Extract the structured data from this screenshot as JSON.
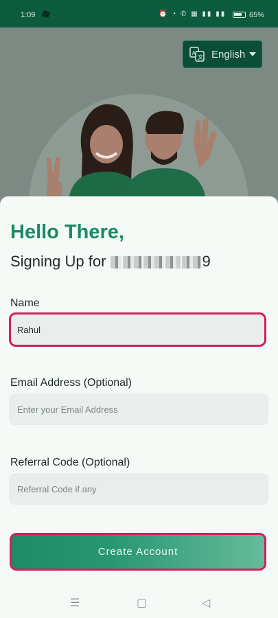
{
  "status_bar": {
    "time": "1:09",
    "battery_percent": "65%",
    "icons": [
      "alarm-icon",
      "wifi-icon",
      "call-icon",
      "volte-icon",
      "signal-icon",
      "signal-icon"
    ]
  },
  "header": {
    "language_label": "English",
    "language_icon": "translate-icon"
  },
  "form": {
    "greeting": "Hello There,",
    "signup_prefix": "Signing Up for",
    "phone_suffix": "9",
    "name": {
      "label": "Name",
      "value": "Rahul"
    },
    "email": {
      "label": "Email Address (Optional)",
      "placeholder": "Enter your Email Address"
    },
    "referral": {
      "label": "Referral Code (Optional)",
      "placeholder": "Referral Code if any"
    },
    "submit_label": "Create Account"
  },
  "nav_bar": {
    "menu": "☰",
    "home": "▢",
    "back": "◁"
  },
  "colors": {
    "primary": "#1b8a62",
    "highlight": "#d31e5b",
    "status_bar": "#0c5b3f"
  }
}
